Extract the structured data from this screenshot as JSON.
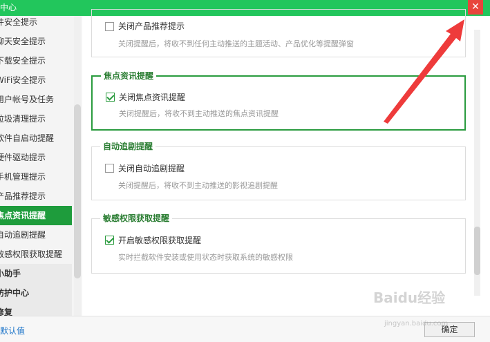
{
  "window": {
    "title": "中心",
    "close_glyph": "✕"
  },
  "sidebar": {
    "items": [
      {
        "label": "件安全提示"
      },
      {
        "label": "聊天安全提示"
      },
      {
        "label": "下载安全提示"
      },
      {
        "label": "WiFi安全提示"
      },
      {
        "label": "用户帐号及任务"
      },
      {
        "label": "垃圾清理提示"
      },
      {
        "label": "软件自启动提醒"
      },
      {
        "label": "硬件驱动提示"
      },
      {
        "label": "手机管理提示"
      },
      {
        "label": "产品推荐提示"
      },
      {
        "label": "焦点资讯提醒"
      },
      {
        "label": "自动追剧提醒"
      },
      {
        "label": "敏感权限获取提醒"
      },
      {
        "label": "小助手"
      },
      {
        "label": "防护中心"
      },
      {
        "label": "修复"
      }
    ]
  },
  "sections": [
    {
      "legend": "",
      "label": "关闭产品推荐提示",
      "desc": "关闭提醒后，将收不到任何主动推送的主题活动、产品优化等提醒弹窗",
      "checked": false
    },
    {
      "legend": "焦点资讯提醒",
      "label": "关闭焦点资讯提醒",
      "desc": "关闭提醒后，将收不到主动推送的焦点资讯提醒",
      "checked": true
    },
    {
      "legend": "自动追剧提醒",
      "label": "关闭自动追剧提醒",
      "desc": "关闭提醒后，将收不到主动推送的影视追剧提醒",
      "checked": false
    },
    {
      "legend": "敏感权限获取提醒",
      "label": "开启敏感权限获取提醒",
      "desc": "实时拦截软件安装或使用状态时获取系统的敏感权限",
      "checked": true
    }
  ],
  "footer": {
    "restore_default": "默认值",
    "ok_label": "确定"
  },
  "watermark": {
    "brand": "Baidu经验",
    "url": "jingyan.baidu.com"
  },
  "colors": {
    "accent": "#22c65c",
    "selected": "#1e9c3c",
    "close": "#e8453c",
    "arrow": "#ee3b3b"
  }
}
